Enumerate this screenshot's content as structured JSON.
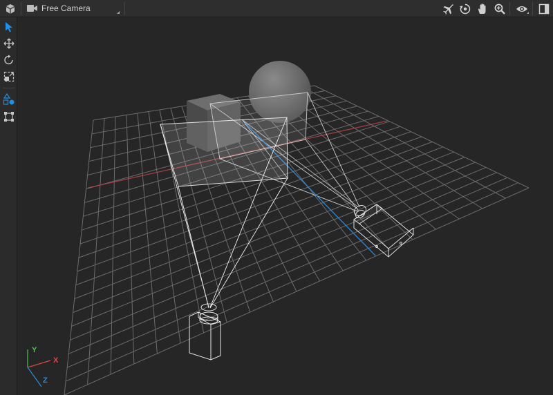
{
  "toolbar": {
    "camera_select": {
      "label": "Free Camera"
    },
    "icons": [
      "cube-icon",
      "video-camera-icon",
      "fly-icon",
      "orbit-icon",
      "pan-hand-icon",
      "zoom-icon",
      "eye-icon",
      "panel-toggle-icon"
    ]
  },
  "left_toolbar": {
    "tools": [
      "select-tool",
      "move-tool",
      "rotate-tool",
      "scale-tool",
      "shapes-tool",
      "transform-box-tool"
    ],
    "active_tool": "select-tool"
  },
  "gizmo": {
    "x_label": "X",
    "y_label": "Y",
    "z_label": "Z"
  },
  "colors": {
    "accent": "#1e90e6",
    "x_axis": "#e04646",
    "y_axis": "#4ec04e",
    "z_axis": "#2a8ce0",
    "grid": "#6c6c6c",
    "background": "#262626"
  }
}
